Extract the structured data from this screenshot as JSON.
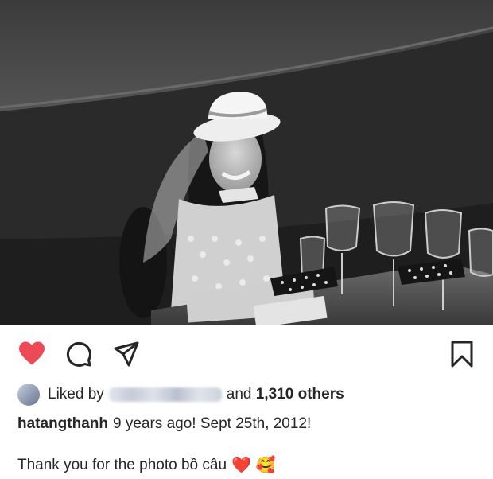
{
  "post": {
    "liked_by": {
      "prefix": "Liked by",
      "connector": "and",
      "others": "1,310 others"
    },
    "caption": {
      "username": "hatangthanh",
      "text": "9 years ago! Sept 25th, 2012!"
    },
    "comment": {
      "text": "Thank you for the photo bồ câu",
      "emoji_heart": "❤️",
      "emoji_face": "🥰"
    },
    "icons": {
      "like": "heart-icon",
      "comment": "comment-icon",
      "share": "send-icon",
      "save": "bookmark-icon"
    },
    "colors": {
      "like_active": "#ed4956",
      "text": "#262626",
      "icon": "#262626"
    }
  }
}
